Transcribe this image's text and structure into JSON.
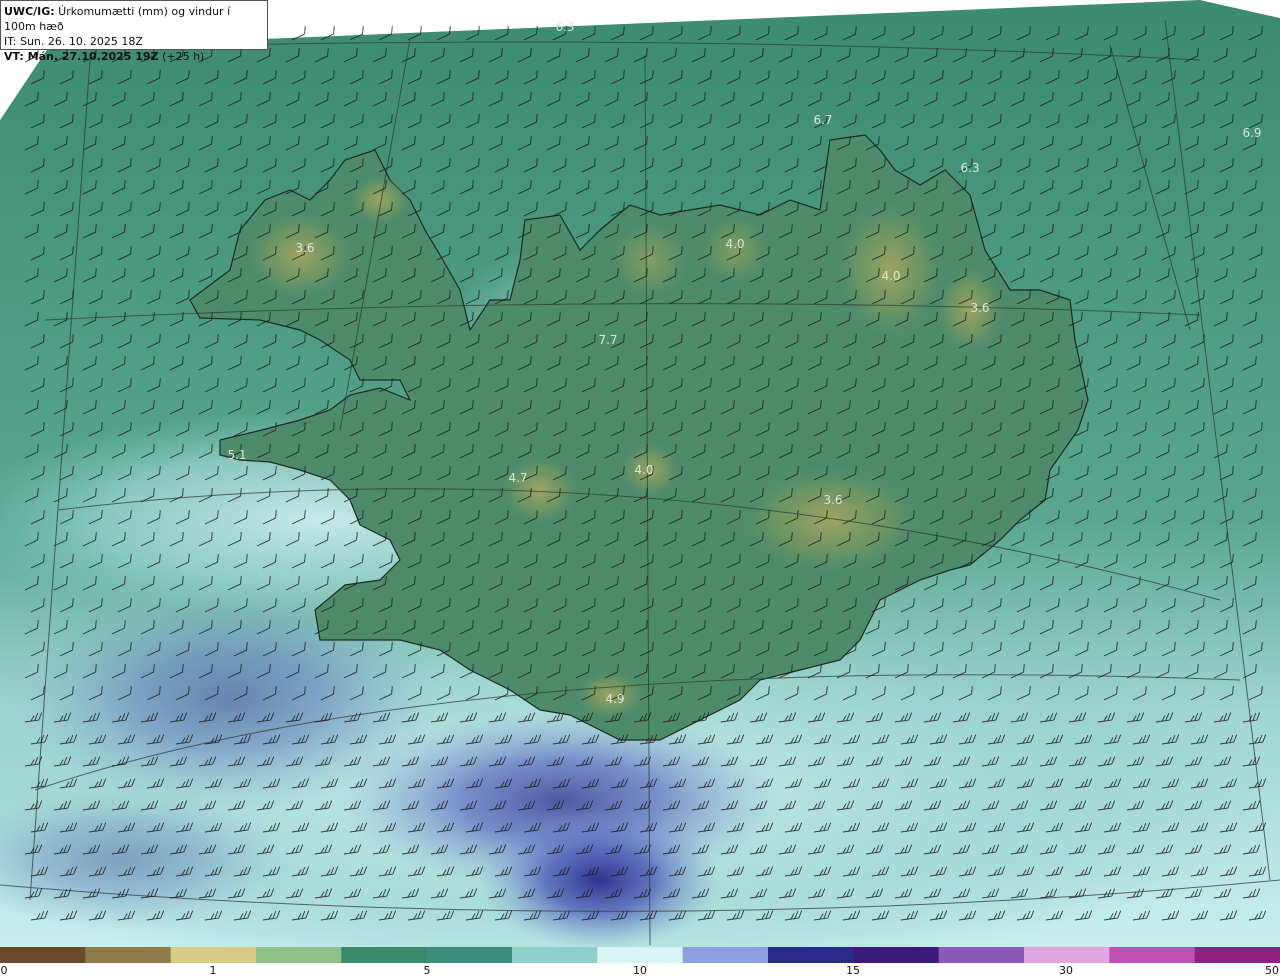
{
  "header": {
    "product": "UWC/IG:",
    "title": " Úrkomumætti (mm) og vindur í 100m hæð",
    "init_time": "IT: Sun. 26. 10. 2025 18Z",
    "valid_prefix": "VT: ",
    "valid_time": "Mán. 27.10.2025 19Z",
    "lead": " (+25 h)"
  },
  "colors": {
    "land_high": "#8a9a5b",
    "land_mid": "#4f8f6d",
    "sea_base": "#3f8f74",
    "moist_light": "#a8ddd8",
    "moist_blue": "#6f82cf",
    "moist_deep": "#2a2a8c",
    "coast": "#1c2a22",
    "grid": "#2d3a35",
    "barb": "#1a1a1a"
  },
  "map_values": [
    {
      "text": "6.3",
      "name": "value-6-3-north"
    },
    {
      "text": "6.7",
      "name": "value-6-7-north"
    },
    {
      "text": "6.9",
      "name": "value-6-9-northeast"
    },
    {
      "text": "6.3",
      "name": "value-6-3-east"
    },
    {
      "text": "3.6",
      "name": "value-3-6-westfjords"
    },
    {
      "text": "4.0",
      "name": "value-4-0-trollaskagi"
    },
    {
      "text": "4.0",
      "name": "value-4-0-northeast"
    },
    {
      "text": "3.6",
      "name": "value-3-6-east"
    },
    {
      "text": "7.7",
      "name": "value-7-7-central"
    },
    {
      "text": "5.1",
      "name": "value-5-1-snaefellsnes"
    },
    {
      "text": "4.7",
      "name": "value-4-7-langjokull"
    },
    {
      "text": "4.0",
      "name": "value-4-0-hofsjokull"
    },
    {
      "text": "3.6",
      "name": "value-3-6-vatnajokull"
    },
    {
      "text": "4.9",
      "name": "value-4-9-myrdalsjokull"
    }
  ],
  "legend": {
    "labels": [
      "0",
      "1",
      "5",
      "10",
      "15",
      "30",
      "50"
    ],
    "colors": [
      "#6b4a2b",
      "#8f7a4a",
      "#d6cc88",
      "#8fc087",
      "#3c8a6c",
      "#3e8f7a",
      "#8fd0cc",
      "#d9f4f4",
      "#8f9ee0",
      "#2a2a8c",
      "#3a1a7a",
      "#8a58b8",
      "#e0a6e0",
      "#c050b0",
      "#902080"
    ]
  }
}
